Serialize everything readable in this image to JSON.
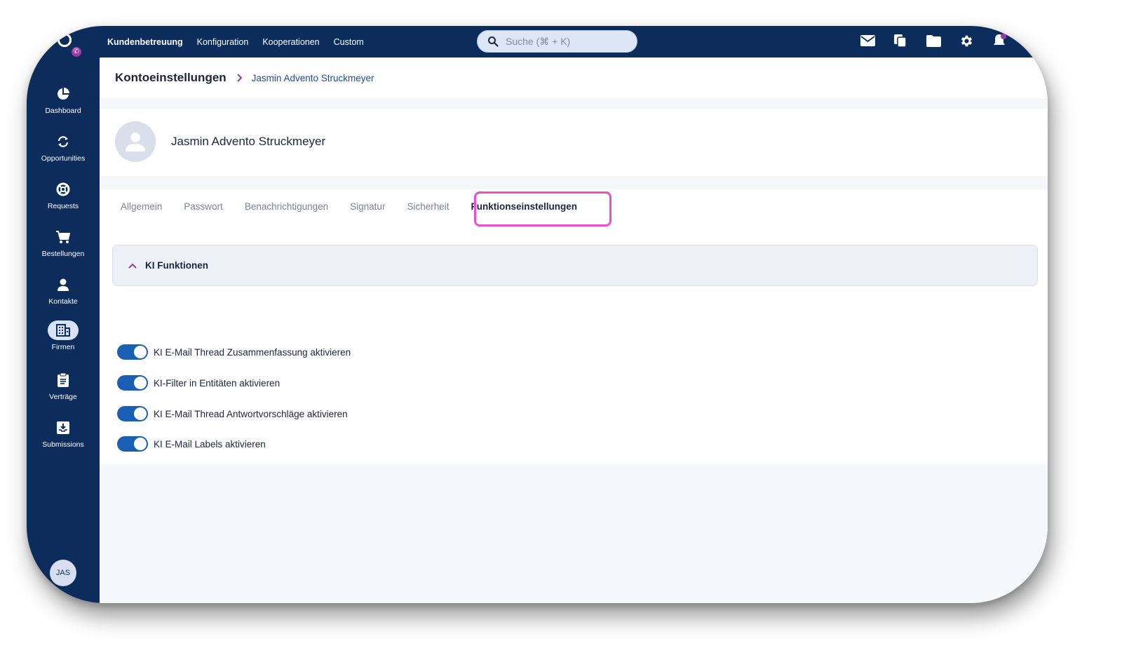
{
  "topbar": {
    "nav": [
      {
        "label": "Kundenbetreuung",
        "active": true
      },
      {
        "label": "Konfiguration",
        "active": false
      },
      {
        "label": "Kooperationen",
        "active": false
      },
      {
        "label": "Custom",
        "active": false
      }
    ],
    "search_placeholder": "Suche (⌘ + K)",
    "icons": [
      "mail-icon",
      "copy-icon",
      "folder-icon",
      "settings-icon",
      "bell-icon"
    ]
  },
  "sidebar": {
    "items": [
      {
        "label": "Dashboard",
        "icon": "pie-chart-icon"
      },
      {
        "label": "Opportunities",
        "icon": "refresh-icon"
      },
      {
        "label": "Requests",
        "icon": "lifebuoy-icon"
      },
      {
        "label": "Bestellungen",
        "icon": "cart-icon"
      },
      {
        "label": "Kontakte",
        "icon": "person-icon"
      },
      {
        "label": "Firmen",
        "icon": "building-icon",
        "active": true
      },
      {
        "label": "Verträge",
        "icon": "clipboard-icon"
      },
      {
        "label": "Submissions",
        "icon": "inbox-download-icon"
      }
    ],
    "user_initials": "JAS"
  },
  "breadcrumb": {
    "title": "Kontoeinstellungen",
    "current": "Jasmin Advento Struckmeyer"
  },
  "profile": {
    "name": "Jasmin Advento Struckmeyer"
  },
  "tabs": [
    {
      "label": "Allgemein",
      "active": false
    },
    {
      "label": "Passwort",
      "active": false
    },
    {
      "label": "Benachrichtigungen",
      "active": false
    },
    {
      "label": "Signatur",
      "active": false
    },
    {
      "label": "Sicherheit",
      "active": false
    },
    {
      "label": "Funktionseinstellungen",
      "active": true
    }
  ],
  "section": {
    "title": "KI Funktionen",
    "expanded": true,
    "toggles": [
      {
        "label": "KI E-Mail Thread Zusammenfassung aktivieren",
        "enabled": true
      },
      {
        "label": "KI-Filter in Entitäten aktivieren",
        "enabled": true
      },
      {
        "label": "KI E-Mail Thread Antwortvorschläge aktivieren",
        "enabled": true
      },
      {
        "label": "KI E-Mail Labels aktivieren",
        "enabled": true
      }
    ]
  },
  "colors": {
    "navy": "#0c2d5c",
    "accent_blue": "#1a5fb4",
    "highlight_pink": "#ef4fcf",
    "badge_purple": "#9b3aa6"
  }
}
